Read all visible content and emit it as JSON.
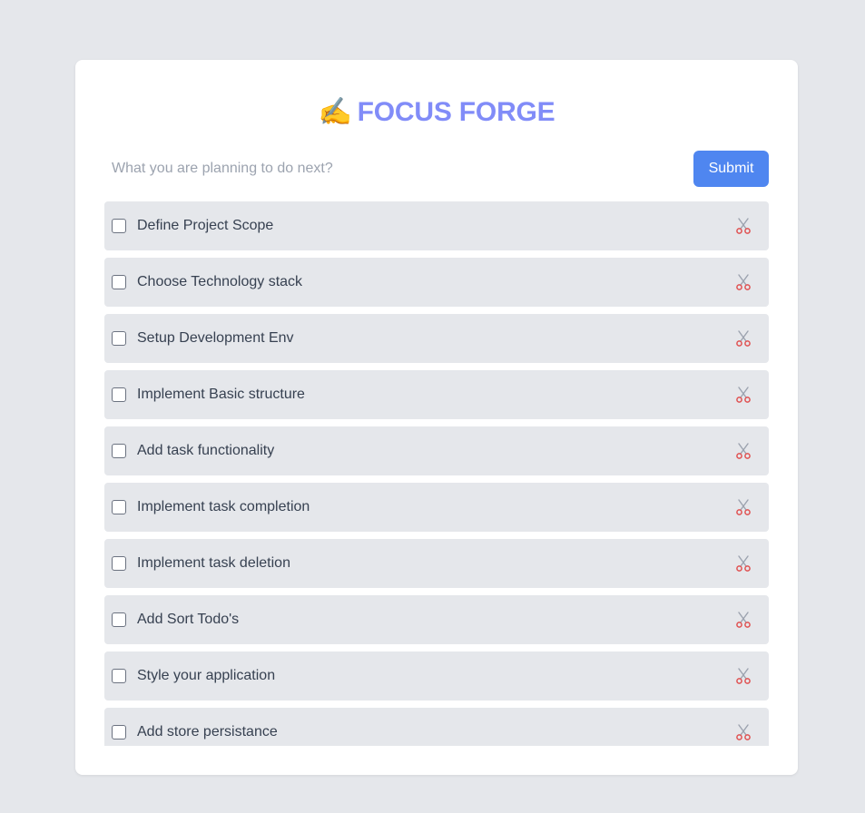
{
  "app": {
    "title_icon": "✍️",
    "title": "FOCUS FORGE"
  },
  "form": {
    "placeholder": "What you are planning to do next?",
    "value": "",
    "submit_label": "Submit"
  },
  "todos": [
    {
      "text": "Define Project Scope",
      "checked": false
    },
    {
      "text": "Choose Technology stack",
      "checked": false
    },
    {
      "text": "Setup Development Env",
      "checked": false
    },
    {
      "text": "Implement Basic structure",
      "checked": false
    },
    {
      "text": "Add task functionality",
      "checked": false
    },
    {
      "text": "Implement task completion",
      "checked": false
    },
    {
      "text": "Implement task deletion",
      "checked": false
    },
    {
      "text": "Add Sort Todo's",
      "checked": false
    },
    {
      "text": "Style your application",
      "checked": false
    },
    {
      "text": "Add store persistance",
      "checked": false
    }
  ],
  "icons": {
    "delete": "scissors-icon",
    "title": "writing-hand-icon"
  },
  "colors": {
    "background": "#e5e7eb",
    "card": "#ffffff",
    "title": "#818cf8",
    "accent": "#4f86f0",
    "item": "#e5e7eb",
    "delete": "#e05252"
  }
}
